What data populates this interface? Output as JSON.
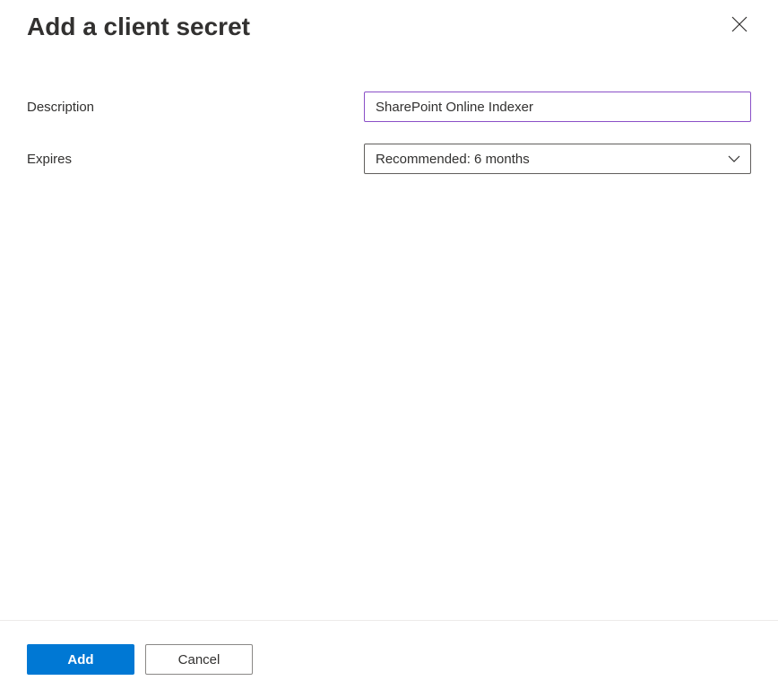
{
  "title": "Add a client secret",
  "form": {
    "description": {
      "label": "Description",
      "value": "SharePoint Online Indexer"
    },
    "expires": {
      "label": "Expires",
      "selected": "Recommended: 6 months"
    }
  },
  "actions": {
    "add": "Add",
    "cancel": "Cancel"
  }
}
